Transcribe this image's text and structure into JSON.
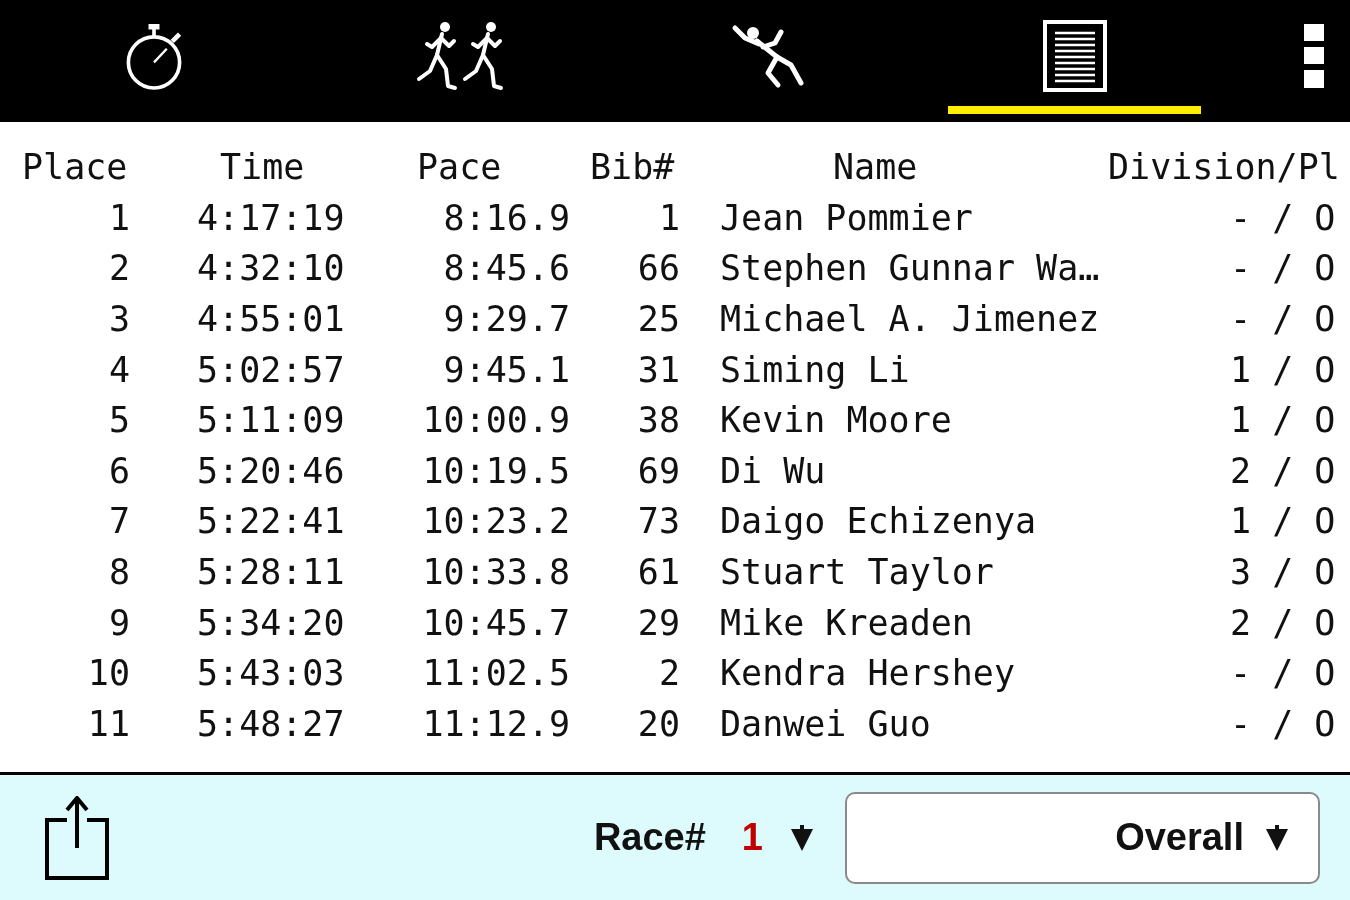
{
  "tabs": [
    {
      "kind": "stopwatch",
      "selected": false
    },
    {
      "kind": "runners",
      "selected": false
    },
    {
      "kind": "sprinter",
      "selected": false
    },
    {
      "kind": "list",
      "selected": true
    }
  ],
  "table": {
    "columns": [
      "Place",
      "Time",
      "Pace",
      "Bib#",
      "Name",
      "Division/Pl"
    ],
    "rows": [
      [
        "1",
        "4:17:19",
        "8:16.9",
        "1",
        "Jean Pommier",
        "- / O"
      ],
      [
        "2",
        "4:32:10",
        "8:45.6",
        "66",
        "Stephen Gunnar Wa…",
        "- / O"
      ],
      [
        "3",
        "4:55:01",
        "9:29.7",
        "25",
        "Michael A. Jimenez",
        "- / O"
      ],
      [
        "4",
        "5:02:57",
        "9:45.1",
        "31",
        "Siming Li",
        "1 / O"
      ],
      [
        "5",
        "5:11:09",
        "10:00.9",
        "38",
        "Kevin Moore",
        "1 / O"
      ],
      [
        "6",
        "5:20:46",
        "10:19.5",
        "69",
        "Di Wu",
        "2 / O"
      ],
      [
        "7",
        "5:22:41",
        "10:23.2",
        "73",
        "Daigo Echizenya",
        "1 / O"
      ],
      [
        "8",
        "5:28:11",
        "10:33.8",
        "61",
        "Stuart Taylor",
        "3 / O"
      ],
      [
        "9",
        "5:34:20",
        "10:45.7",
        "29",
        "Mike Kreaden",
        "2 / O"
      ],
      [
        "10",
        "5:43:03",
        "11:02.5",
        "2",
        "Kendra Hershey",
        "- / O"
      ],
      [
        "11",
        "5:48:27",
        "11:12.9",
        "20",
        "Danwei Guo",
        "- / O"
      ]
    ]
  },
  "bottom_bar": {
    "race_label": "Race#",
    "race_number": "1",
    "category": "Overall"
  }
}
